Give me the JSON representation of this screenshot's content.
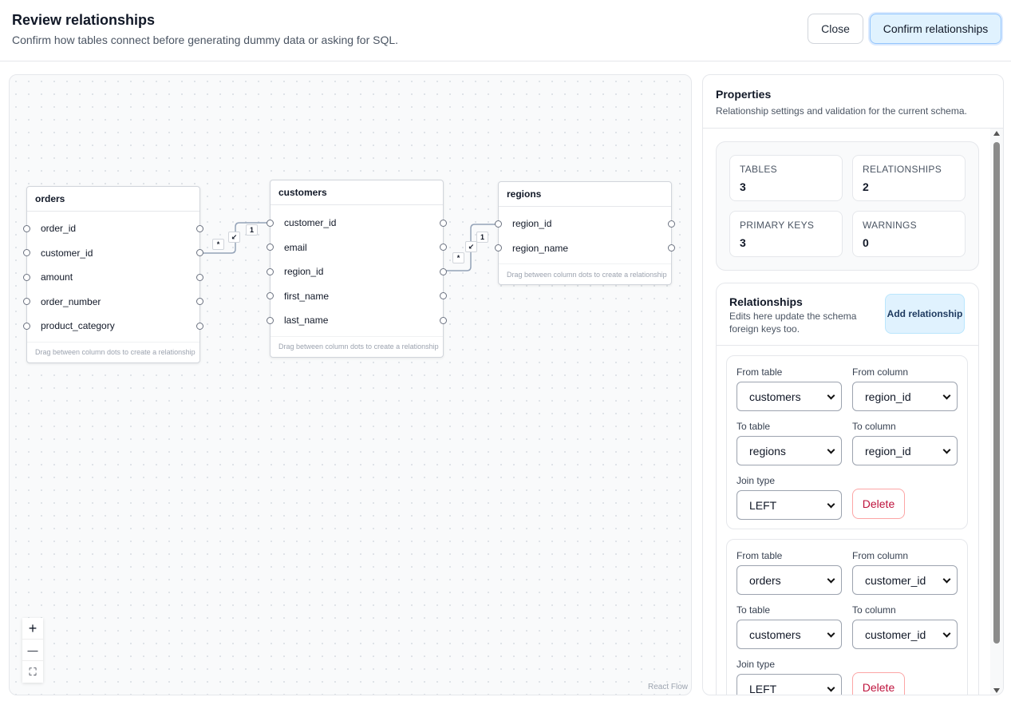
{
  "header": {
    "title": "Review relationships",
    "subtitle": "Confirm how tables connect before generating dummy data or asking for SQL.",
    "close_label": "Close",
    "confirm_label": "Confirm relationships"
  },
  "canvas": {
    "hint": "Drag between column dots to create a relationship",
    "attribution": "React Flow",
    "controls": {
      "zoom_in": "+",
      "zoom_out": "—",
      "fit": "⛶"
    },
    "tables": [
      {
        "name": "orders",
        "columns": [
          "order_id",
          "customer_id",
          "amount",
          "order_number",
          "product_category"
        ]
      },
      {
        "name": "customers",
        "columns": [
          "customer_id",
          "email",
          "region_id",
          "first_name",
          "last_name"
        ]
      },
      {
        "name": "regions",
        "columns": [
          "region_id",
          "region_name"
        ]
      }
    ],
    "edges": [
      {
        "source_label": "*",
        "target_label": "1",
        "mid_label": "↙"
      },
      {
        "source_label": "*",
        "target_label": "1",
        "mid_label": "↙"
      }
    ]
  },
  "panel": {
    "title": "Properties",
    "subtitle": "Relationship settings and validation for the current schema.",
    "stats": [
      {
        "label": "TABLES",
        "value": "3"
      },
      {
        "label": "RELATIONSHIPS",
        "value": "2"
      },
      {
        "label": "PRIMARY KEYS",
        "value": "3"
      },
      {
        "label": "WARNINGS",
        "value": "0"
      }
    ],
    "relationships": {
      "title": "Relationships",
      "subtitle": "Edits here update the schema foreign keys too.",
      "add_label": "Add relationship",
      "labels": {
        "from_table": "From table",
        "from_column": "From column",
        "to_table": "To table",
        "to_column": "To column",
        "join_type": "Join type",
        "delete": "Delete"
      },
      "items": [
        {
          "from_table": "customers",
          "from_column": "region_id",
          "to_table": "regions",
          "to_column": "region_id",
          "join_type": "LEFT"
        },
        {
          "from_table": "orders",
          "from_column": "customer_id",
          "to_table": "customers",
          "to_column": "customer_id",
          "join_type": "LEFT"
        }
      ]
    }
  }
}
